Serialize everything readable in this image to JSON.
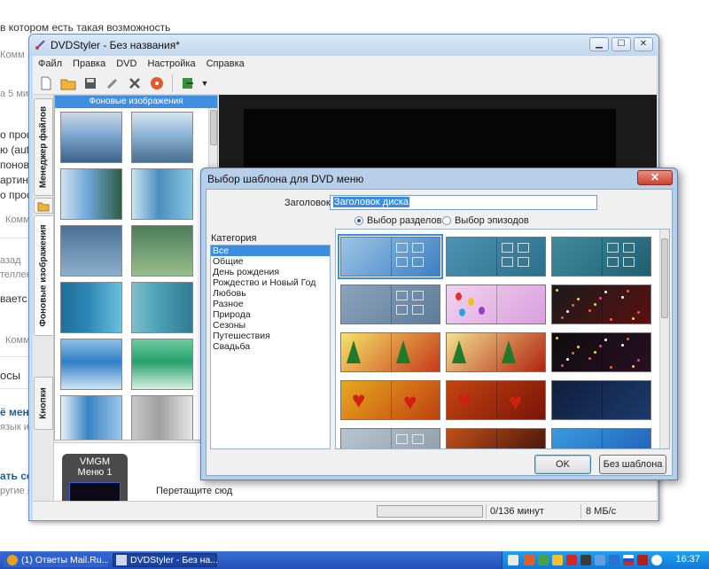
{
  "background": {
    "lines": [
      "в котором есть такая возможность",
      "Комм",
      "а 5 мин",
      "о проф",
      "ю (aut",
      "понов",
      "артин",
      "о прос",
      "Комм",
      "азад",
      "теллек",
      "ваетс",
      "Комм",
      "осы",
      "ё мени",
      "язык и",
      "ать се",
      "ругие я"
    ]
  },
  "window": {
    "title": "DVDStyler - Без названия*",
    "controls": {
      "minimize": "▁",
      "maximize": "☐",
      "close": "✕"
    },
    "menu": [
      "Файл",
      "Правка",
      "DVD",
      "Настройка",
      "Справка"
    ]
  },
  "toolbar": {
    "icons": [
      "new-file-icon",
      "open-folder-icon",
      "save-icon",
      "settings-icon",
      "tools-icon",
      "burn-disc-icon",
      "export-icon",
      "dropdown-arrow-icon"
    ]
  },
  "side_tabs": [
    "Менеджер файлов",
    "Фоновые изображения",
    "Кнопки"
  ],
  "thumbnails": {
    "header": "Фоновые изображения",
    "items": [
      {
        "name": "sea-coast",
        "colors": [
          "#7fa7cf",
          "#3a6287",
          "#c9d9e4"
        ]
      },
      {
        "name": "ship-harbor",
        "colors": [
          "#8db3d6",
          "#496e8e",
          "#d7e6f0"
        ]
      },
      {
        "name": "green-lake",
        "colors": [
          "#6ea6d8",
          "#305c44",
          "#cfe3f2"
        ]
      },
      {
        "name": "blue-gradient",
        "colors": [
          "#4c8ec0",
          "#88c6e0",
          "#c9e4f1"
        ]
      },
      {
        "name": "blue-texture",
        "colors": [
          "#6b8eb0",
          "#8fb0cc",
          "#4a6f94"
        ]
      },
      {
        "name": "green-texture",
        "colors": [
          "#6f9a72",
          "#98be8c",
          "#4e7d58"
        ]
      },
      {
        "name": "teal-stripes",
        "colors": [
          "#2e86b5",
          "#6cc0dd",
          "#1f6f99"
        ]
      },
      {
        "name": "teal-cloud",
        "colors": [
          "#4aa0b5",
          "#2f7c93",
          "#7fc0cf"
        ]
      },
      {
        "name": "blue-frame",
        "colors": [
          "#2f7fc6",
          "#cfe6f6",
          "#8fc0e6"
        ]
      },
      {
        "name": "green-frame",
        "colors": [
          "#27a06d",
          "#d6f0e2",
          "#6ccaa0"
        ]
      },
      {
        "name": "sky-blue",
        "colors": [
          "#3a82c4",
          "#9cc8ea",
          "#e6f1fa"
        ]
      },
      {
        "name": "grey-frame",
        "colors": [
          "#a0a0a0",
          "#e6e6e6",
          "#c8c8c8"
        ]
      }
    ]
  },
  "vmgm": {
    "label": "VMGM",
    "menu": "Меню 1"
  },
  "drag_hint": "Перетащите сюд",
  "status": {
    "duration": "0/136 минут",
    "speed": "8 МБ/с"
  },
  "dialog": {
    "title": "Выбор шаблона для DVD меню",
    "close": "✕",
    "title_label": "Заголовок:",
    "title_value": "Заголовок диска",
    "radio_sections": "Выбор разделов",
    "radio_episodes": "Выбор эпизодов",
    "radio_selected": "sections",
    "category_label": "Категория",
    "categories": [
      "Все",
      "Общие",
      "День рождения",
      "Рождество и Новый Год",
      "Любовь",
      "Разное",
      "Природа",
      "Сезоны",
      "Путешествия",
      "Свадьба"
    ],
    "selected_category": 0,
    "templates": [
      {
        "name": "template-blue-swirl",
        "colors": [
          "#9cc4e6",
          "#3d7fc4"
        ],
        "style": "boxes"
      },
      {
        "name": "template-teal-boxes",
        "colors": [
          "#4c94b4",
          "#2c6f8c"
        ],
        "style": "boxes"
      },
      {
        "name": "template-teal-dark",
        "colors": [
          "#3f8c9e",
          "#1f5f70"
        ],
        "style": "boxes"
      },
      {
        "name": "template-grey-blue",
        "colors": [
          "#8ba3bb",
          "#5e7c99"
        ],
        "style": "boxes"
      },
      {
        "name": "template-pink-balloons",
        "colors": [
          "#f0d2ef",
          "#d9a0dc"
        ],
        "style": "balloons"
      },
      {
        "name": "template-cake-dark",
        "colors": [
          "#1b1b1b",
          "#5a1010"
        ],
        "style": "sparkle"
      },
      {
        "name": "template-xmas-yellow",
        "colors": [
          "#f6e26a",
          "#c63a1a"
        ],
        "style": "xmas"
      },
      {
        "name": "template-xmas-red",
        "colors": [
          "#f4e090",
          "#b02410"
        ],
        "style": "xmas"
      },
      {
        "name": "template-fireworks",
        "colors": [
          "#0d0d0d",
          "#2a0f22"
        ],
        "style": "sparkle"
      },
      {
        "name": "template-hearts-gold",
        "colors": [
          "#e8a820",
          "#c04010"
        ],
        "style": "hearts"
      },
      {
        "name": "template-hearts-red",
        "colors": [
          "#c44410",
          "#7a1408"
        ],
        "style": "hearts"
      },
      {
        "name": "template-dark-blue",
        "colors": [
          "#0f1e3c",
          "#1c3a6c"
        ],
        "style": "plain"
      },
      {
        "name": "template-grey-circles",
        "colors": [
          "#b8c4ce",
          "#8f9ca8"
        ],
        "style": "boxes"
      },
      {
        "name": "template-orange-dark",
        "colors": [
          "#c0501a",
          "#3a0f08"
        ],
        "style": "plain"
      },
      {
        "name": "template-blue-bright",
        "colors": [
          "#3a9ae0",
          "#1d5fb8"
        ],
        "style": "plain"
      }
    ],
    "ok": "OK",
    "no_template": "Без шаблона"
  },
  "taskbar": {
    "tasks": [
      "(1) Ответы Mail.Ru...",
      "DVDStyler - Без на..."
    ],
    "active_task": 1,
    "clock": "16:37"
  }
}
